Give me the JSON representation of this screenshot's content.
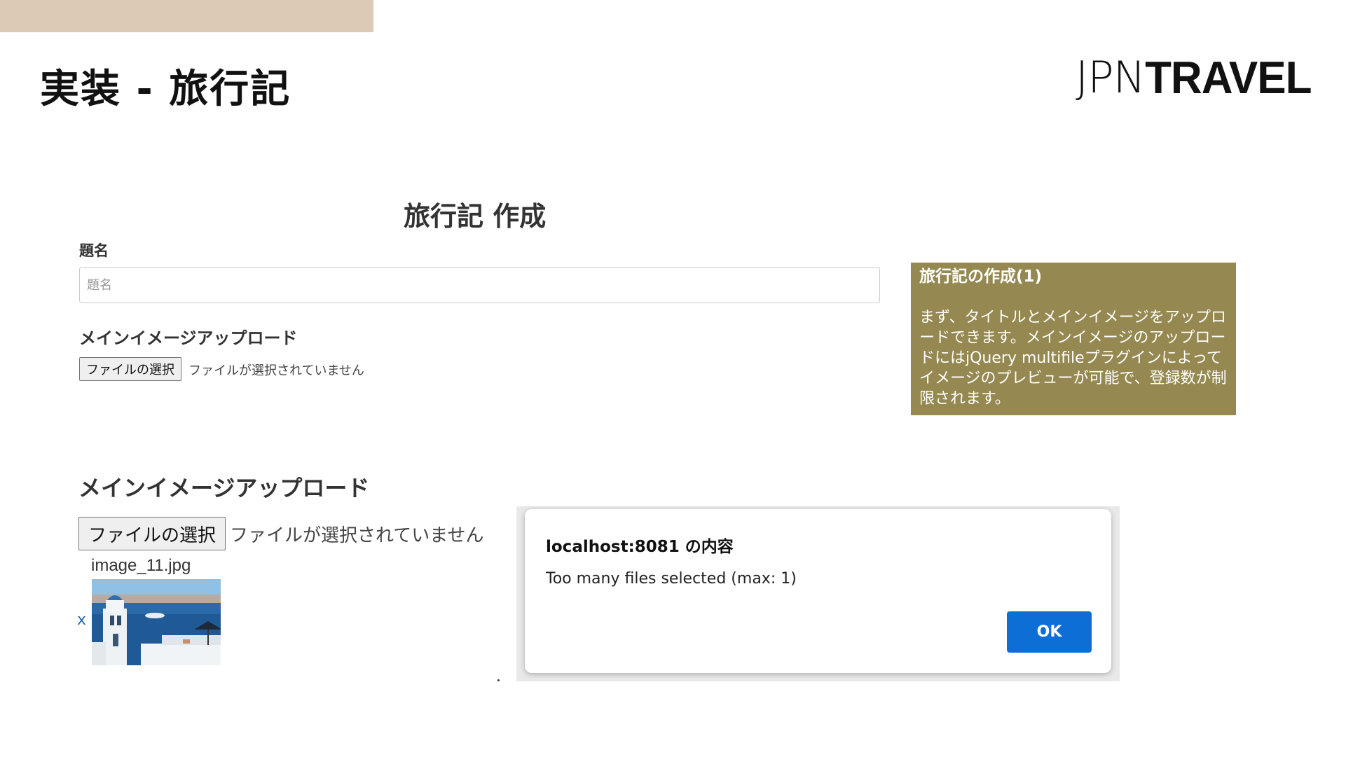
{
  "slide": {
    "title": "実装 - 旅行記",
    "logo_thin": "JPN",
    "logo_bold": "TRAVEL",
    "accent_color": "#dccab6"
  },
  "form": {
    "heading": "旅行記 作成",
    "title_label": "題名",
    "title_placeholder": "題名",
    "upload_label": "メインイメージアップロード",
    "file_button": "ファイルの選択",
    "file_status": "ファイルが選択されていません"
  },
  "note": {
    "title": "旅行記の作成(1)",
    "body": "まず、タイトルとメインイメージをアップロードできます。メインイメージのアップロードにはjQuery multifileプラグインによってイメージのプレビューが可能で、登録数が制限されます。",
    "bg_color": "#958850"
  },
  "upload_zoom": {
    "label": "メインイメージアップロード",
    "file_button": "ファイルの選択",
    "file_status": "ファイルが選択されていません",
    "filename": "image_11.jpg",
    "remove": "x"
  },
  "dialog": {
    "title": "localhost:8081 の内容",
    "message": "Too many files selected (max: 1)",
    "ok_label": "OK",
    "ok_color": "#0d6fd6"
  }
}
